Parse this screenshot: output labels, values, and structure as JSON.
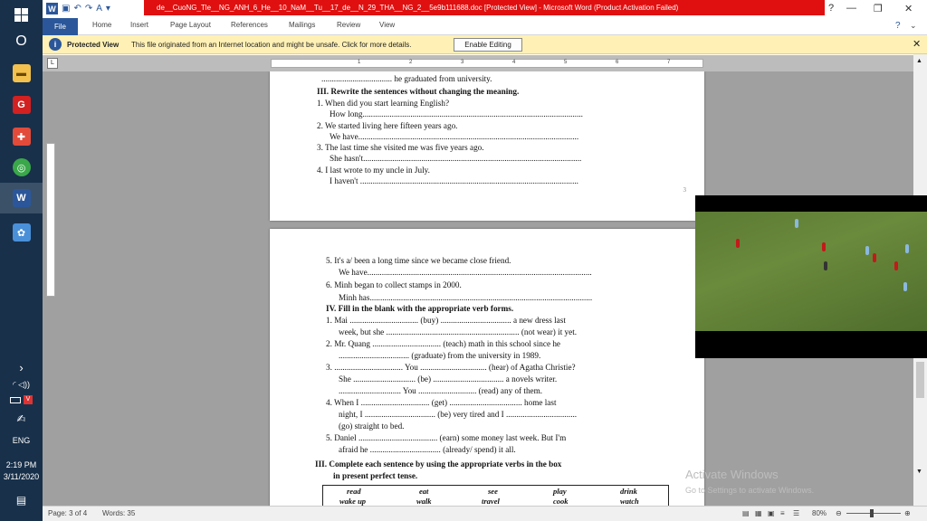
{
  "window": {
    "title": "de__CuoNG_Tle__NG_ANH_6_He__10_NaM__Tu__17_de__N_29_THA__NG_2__5e9b111688.doc [Protected View] - Microsoft Word (Product Activation Failed)"
  },
  "taskbar": {
    "start_icon": "windows-start-icon",
    "search_glyph": "O",
    "apps": [
      {
        "name": "file-explorer-icon",
        "color": "#f2c14e",
        "glyph": "▬"
      },
      {
        "name": "garena-icon",
        "color": "#d32020",
        "glyph": "G"
      },
      {
        "name": "puzzle-app-icon",
        "color": "#e24a3a",
        "glyph": "✚"
      },
      {
        "name": "coccoc-browser-icon",
        "color": "#3aa84a",
        "glyph": "◎"
      },
      {
        "name": "word-app-icon",
        "color": "#2b579a",
        "glyph": "W"
      },
      {
        "name": "paint-app-icon",
        "color": "#4a90d9",
        "glyph": "✿"
      }
    ],
    "expand": "›",
    "lang": "ENG",
    "time": "2:19 PM",
    "date": "3/11/2020"
  },
  "ribbon": {
    "tabs": [
      "File",
      "Home",
      "Insert",
      "Page Layout",
      "References",
      "Mailings",
      "Review",
      "View"
    ]
  },
  "protected_view": {
    "label": "Protected View",
    "message": "This file originated from an Internet location and might be unsafe. Click for more details.",
    "button": "Enable Editing"
  },
  "ruler": {
    "numbers": [
      "1",
      "2",
      "3",
      "4",
      "5",
      "6",
      "7"
    ]
  },
  "page1": {
    "lines": [
      ".................................. he graduated from university.",
      "III. Rewrite the sentences without changing the meaning.",
      "1. When did you start learning English?",
      "How long..........................................................................................................",
      "2. We started living here fifteen years ago.",
      "We have..........................................................................................................",
      "3. The last time she visited me was five years ago.",
      "She hasn't.........................................................................................................",
      "4. I last wrote to my uncle in July.",
      "I haven't ........................................................................................................."
    ],
    "page_number": "3"
  },
  "page2": {
    "lines": [
      "5. It's a/ been a long time since we became close friend.",
      "We have............................................................................................................",
      "6. Minh began to collect stamps in 2000.",
      "Minh has...........................................................................................................",
      "IV. Fill in the blank with the appropriate verb forms.",
      "1. Mai ................................. (buy) .................................. a new dress last",
      "week, but she ................................................................ (not wear) it yet.",
      "2. Mr. Quang ................................. (teach) math in this school since he",
      ".................................. (graduate) from the university in 1989.",
      "3. ................................. You ................................ (hear) of Agatha Christie?",
      "She .............................. (be) .................................. a novels writer.",
      ".............................. You ............................ (read) any of them.",
      "4. When I ................................. (get) ................................... home last",
      "night, I .................................. (be) very tired and I ..................................",
      "(go) straight to bed.",
      "5. Daniel ...................................... (earn) some money last week. But I'm",
      "afraid he .................................. (already/ spend) it all.",
      "III. Complete each sentence by using the appropriate verbs in the box",
      "in present perfect tense."
    ],
    "verbs_row1": [
      "read",
      "eat",
      "see",
      "play",
      "drink"
    ],
    "verbs_row2": [
      "wake up",
      "walk",
      "travel",
      "cook",
      "watch"
    ]
  },
  "watermark": {
    "title": "Activate Windows",
    "subtitle": "Go to Settings to activate Windows."
  },
  "status": {
    "page": "Page: 3 of 4",
    "words": "Words: 35",
    "zoom": "80%"
  }
}
